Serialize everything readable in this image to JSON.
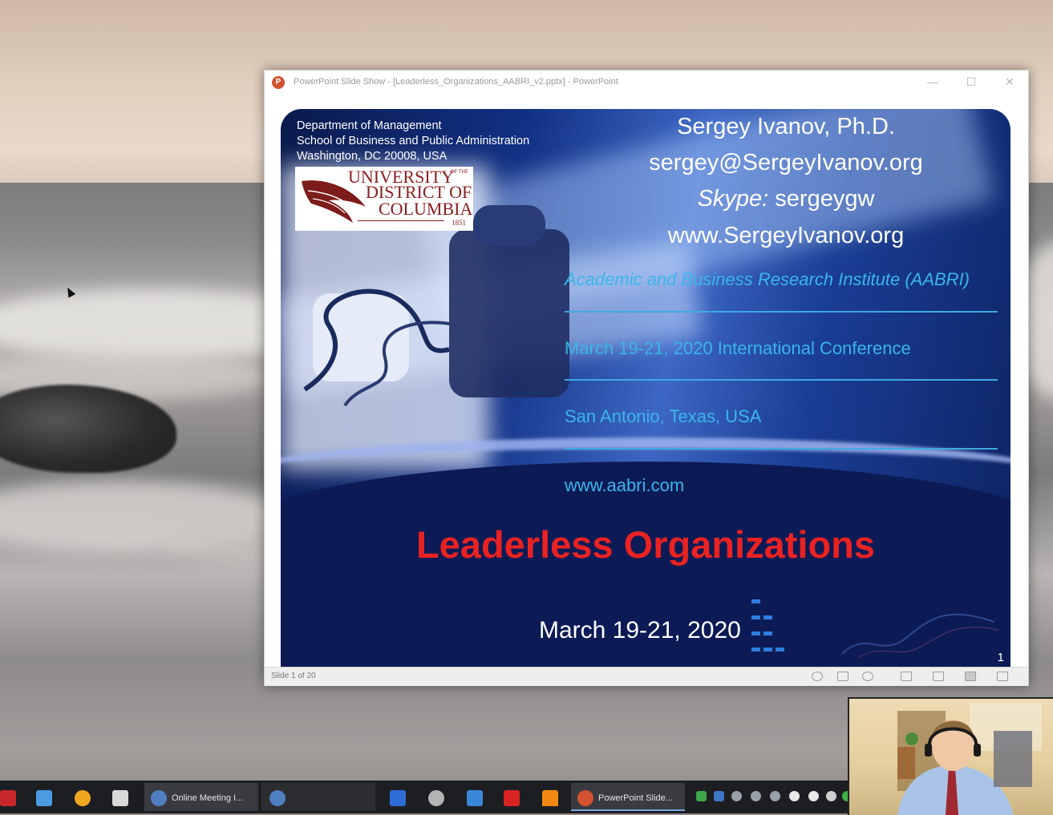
{
  "window": {
    "title": "PowerPoint Slide Show - [Leaderless_Organizations_AABRI_v2.pptx] - PowerPoint",
    "minimize_glyph": "—",
    "maximize_glyph": "☐",
    "close_glyph": "✕",
    "status": "Slide 1 of 20"
  },
  "slide": {
    "department": [
      "Department of Management",
      "School of Business and Public Administration",
      "Washington, DC 20008, USA"
    ],
    "logo": {
      "line1": "UNIVERSITY",
      "line2": "DISTRICT OF",
      "line3": "COLUMBIA",
      "small_of": "OF THE",
      "year": "1851"
    },
    "presenter": {
      "name": "Sergey Ivanov, Ph.D.",
      "email": "sergey@SergeyIvanov.org",
      "skype_label": "Skype:",
      "skype_handle": " sergeygw",
      "website": "www.SergeyIvanov.org"
    },
    "conference": {
      "institute": "Academic and Business Research Institute (AABRI)",
      "event": "March 19-21, 2020 International Conference",
      "location": "San Antonio, Texas, USA",
      "url": "www.aabri.com"
    },
    "title": "Leaderless Organizations",
    "date": "March 19-21, 2020",
    "number": "1"
  },
  "taskbar": {
    "items": [
      {
        "icon": "red-app-icon",
        "color": "#c8262a"
      },
      {
        "icon": "files-icon",
        "color": "#4a9be0"
      },
      {
        "icon": "weather-icon",
        "color": "#f0a720"
      },
      {
        "icon": "calculator-icon",
        "color": "#d9d9d9"
      },
      {
        "icon": "meeting-icon",
        "label": "Online Meeting I...",
        "color": "#4f7fbf"
      },
      {
        "icon": "meeting-icon-2",
        "color": "#4f7fbf"
      },
      {
        "icon": "bar-chart-icon",
        "color": "#2e6dd6"
      },
      {
        "icon": "cloud-app-icon",
        "color": "#b3b3b3"
      },
      {
        "icon": "notepad-icon",
        "color": "#3c86d9"
      },
      {
        "icon": "pdf-icon",
        "color": "#d82323"
      },
      {
        "icon": "vlc-icon",
        "color": "#f08a12"
      },
      {
        "icon": "powerpoint-icon",
        "label": "PowerPoint Slide...",
        "color": "#d35230"
      }
    ],
    "tray_colors": [
      "#3ea748",
      "#3e77c8",
      "#9aa0a8",
      "#9aa0a8",
      "#9aa0a8",
      "#e8e8e8",
      "#e8e8e8",
      "#cfcfcf",
      "#3fb04a"
    ]
  }
}
